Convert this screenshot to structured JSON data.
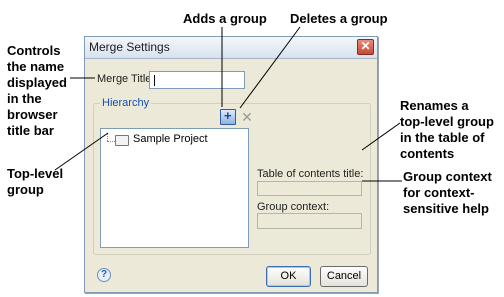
{
  "annotations": {
    "adds_group": "Adds a group",
    "deletes_group": "Deletes a group",
    "controls_name": "Controls\nthe name\ndisplayed\nin the\nbrowser\ntitle bar",
    "renames_group": "Renames a\ntop-level group\nin the table of\ncontents",
    "top_level_group": "Top-level\ngroup",
    "group_context": "Group context\nfor context-\nsensitive help"
  },
  "dialog": {
    "title": "Merge Settings",
    "close_label": "✕",
    "merge_title_label": "Merge Title:",
    "merge_title_value": "",
    "hierarchy_label": "Hierarchy",
    "tree_items": [
      "Sample Project"
    ],
    "toc_title_label": "Table of contents title:",
    "toc_title_value": "",
    "group_context_label": "Group context:",
    "group_context_value": "",
    "help_label": "?",
    "ok_label": "OK",
    "cancel_label": "Cancel"
  },
  "icons": {
    "add_group": "add-group-icon",
    "delete_group": "delete-group-icon",
    "help": "help-icon",
    "folder": "folder-icon"
  }
}
